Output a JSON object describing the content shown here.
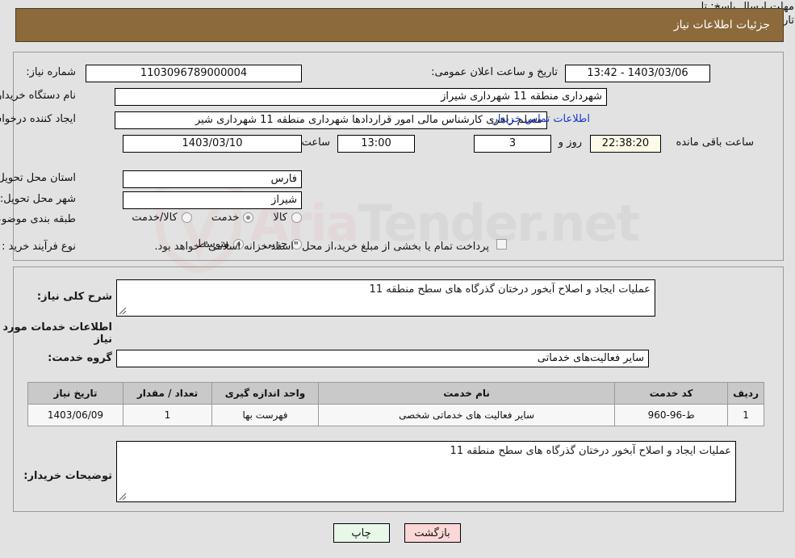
{
  "header": {
    "title": "جزئیات اطلاعات نیاز"
  },
  "watermark": {
    "text_left": "Aria",
    "text_right": "Tender.net",
    "shield": "shield-icon"
  },
  "form": {
    "need_number_label": "شماره نیاز:",
    "need_number": "1103096789000004",
    "announce_datetime_label": "تاریخ و ساعت اعلان عمومی:",
    "announce_datetime": "1403/03/06 - 13:42",
    "buyer_org_label": "نام دستگاه خریدار:",
    "buyer_org": "شهرداری منطقه 11 شهرداری شیراز",
    "creator_label": "ایجاد کننده درخواست:",
    "creator": "مسلم زاهری کارشناس مالی امور قراردادها شهرداری منطقه 11 شهرداری شیر",
    "contact_link": "اطلاعات تماس خریدار",
    "deadline_label": "مهلت ارسال پاسخ: تا تاریخ:",
    "deadline_date": "1403/03/10",
    "hour_label": "ساعت",
    "deadline_hour": "13:00",
    "days_remaining": "3",
    "days_label": "روز و",
    "countdown": "22:38:20",
    "remaining_label": "ساعت باقی مانده",
    "province_label": "استان محل تحویل:",
    "province": "فارس",
    "city_label": "شهر محل تحویل:",
    "city": "شیراز",
    "classification_label": "طبقه بندی موضوعی:",
    "classification_options": [
      {
        "label": "کالا",
        "selected": false
      },
      {
        "label": "خدمت",
        "selected": true
      },
      {
        "label": "کالا/خدمت",
        "selected": false
      }
    ],
    "process_label": "نوع فرآیند خرید :",
    "process_options": [
      {
        "label": "جزیی",
        "selected": false
      },
      {
        "label": "متوسط",
        "selected": true
      }
    ],
    "treasury_checkbox_checked": false,
    "treasury_text": "پرداخت تمام یا بخشی از مبلغ خرید،از محل \"اسناد خزانه اسلامی\" خواهد بود."
  },
  "details": {
    "general_desc_label": "شرح کلی نیاز:",
    "general_desc": "عملیات ایجاد و اصلاح آبخور درختان گذرگاه های سطح منطقه 11",
    "services_heading": "اطلاعات خدمات مورد نیاز",
    "service_group_label": "گروه خدمت:",
    "service_group": "سایر فعالیت‌های خدماتی"
  },
  "table": {
    "columns": [
      "ردیف",
      "کد خدمت",
      "نام خدمت",
      "واحد اندازه گیری",
      "تعداد / مقدار",
      "تاریخ نیاز"
    ],
    "rows": [
      [
        "1",
        "ط-96-960",
        "سایر فعالیت های خدماتی شخصی",
        "فهرست بها",
        "1",
        "1403/06/09"
      ]
    ]
  },
  "notes": {
    "label": "توضیحات خریدار:",
    "value": "عملیات ایجاد و اصلاح آبخور درختان گذرگاه های سطح منطقه 11"
  },
  "buttons": {
    "print": "چاپ",
    "back": "بازگشت"
  },
  "colors": {
    "header_bg": "#8d6a3b",
    "page_bg": "#e2e2e2",
    "link": "#1538c8",
    "table_header_bg": "#c9c9c9",
    "print_btn_bg": "#e9f7e9",
    "back_btn_bg": "#fbd7d7",
    "countdown_bg": "#fbfbe8"
  }
}
